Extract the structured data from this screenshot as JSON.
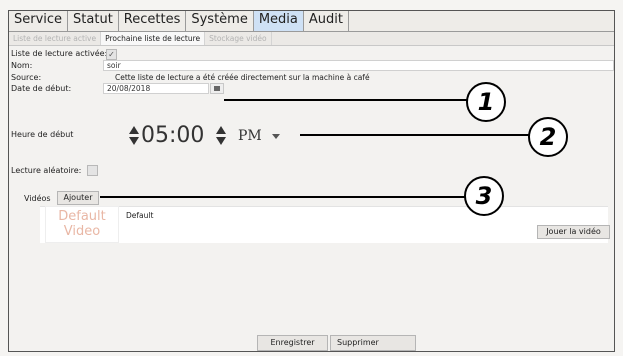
{
  "menu": {
    "tabs": [
      {
        "label": "Service"
      },
      {
        "label": "Statut"
      },
      {
        "label": "Recettes"
      },
      {
        "label": "Système"
      },
      {
        "label": "Media",
        "active": true
      },
      {
        "label": "Audit"
      }
    ]
  },
  "subtabs": [
    {
      "label": "Liste de lecture active",
      "active": false
    },
    {
      "label": "Prochaine liste de lecture",
      "active": true
    },
    {
      "label": "Stockage vidéo",
      "active": false
    }
  ],
  "form": {
    "active_label": "Liste de lecture activée:",
    "active_checked": true,
    "name_label": "Nom:",
    "name_value": "soir",
    "source_label": "Source:",
    "source_value": "Cette liste de lecture a été créée directement sur la machine à café",
    "start_date_label": "Date de début:",
    "start_date_value": "20/08/2018",
    "start_time_label": "Heure de début",
    "start_time_value": "05:00",
    "ampm_value": "PM",
    "shuffle_label": "Lecture aléatoire:",
    "shuffle_checked": false
  },
  "videos": {
    "label": "Vidéos",
    "add_button": "Ajouter",
    "thumb_line1": "Default",
    "thumb_line2": "Video",
    "item_name": "Default",
    "play_button": "Jouer la vidéo"
  },
  "footer": {
    "save_button": "Enregistrer",
    "delete_button": "Supprimer"
  },
  "callouts": [
    "1",
    "2",
    "3"
  ],
  "colors": {
    "active_tab": "#cfe1f5",
    "thumb_text": "#e9b7a5"
  }
}
